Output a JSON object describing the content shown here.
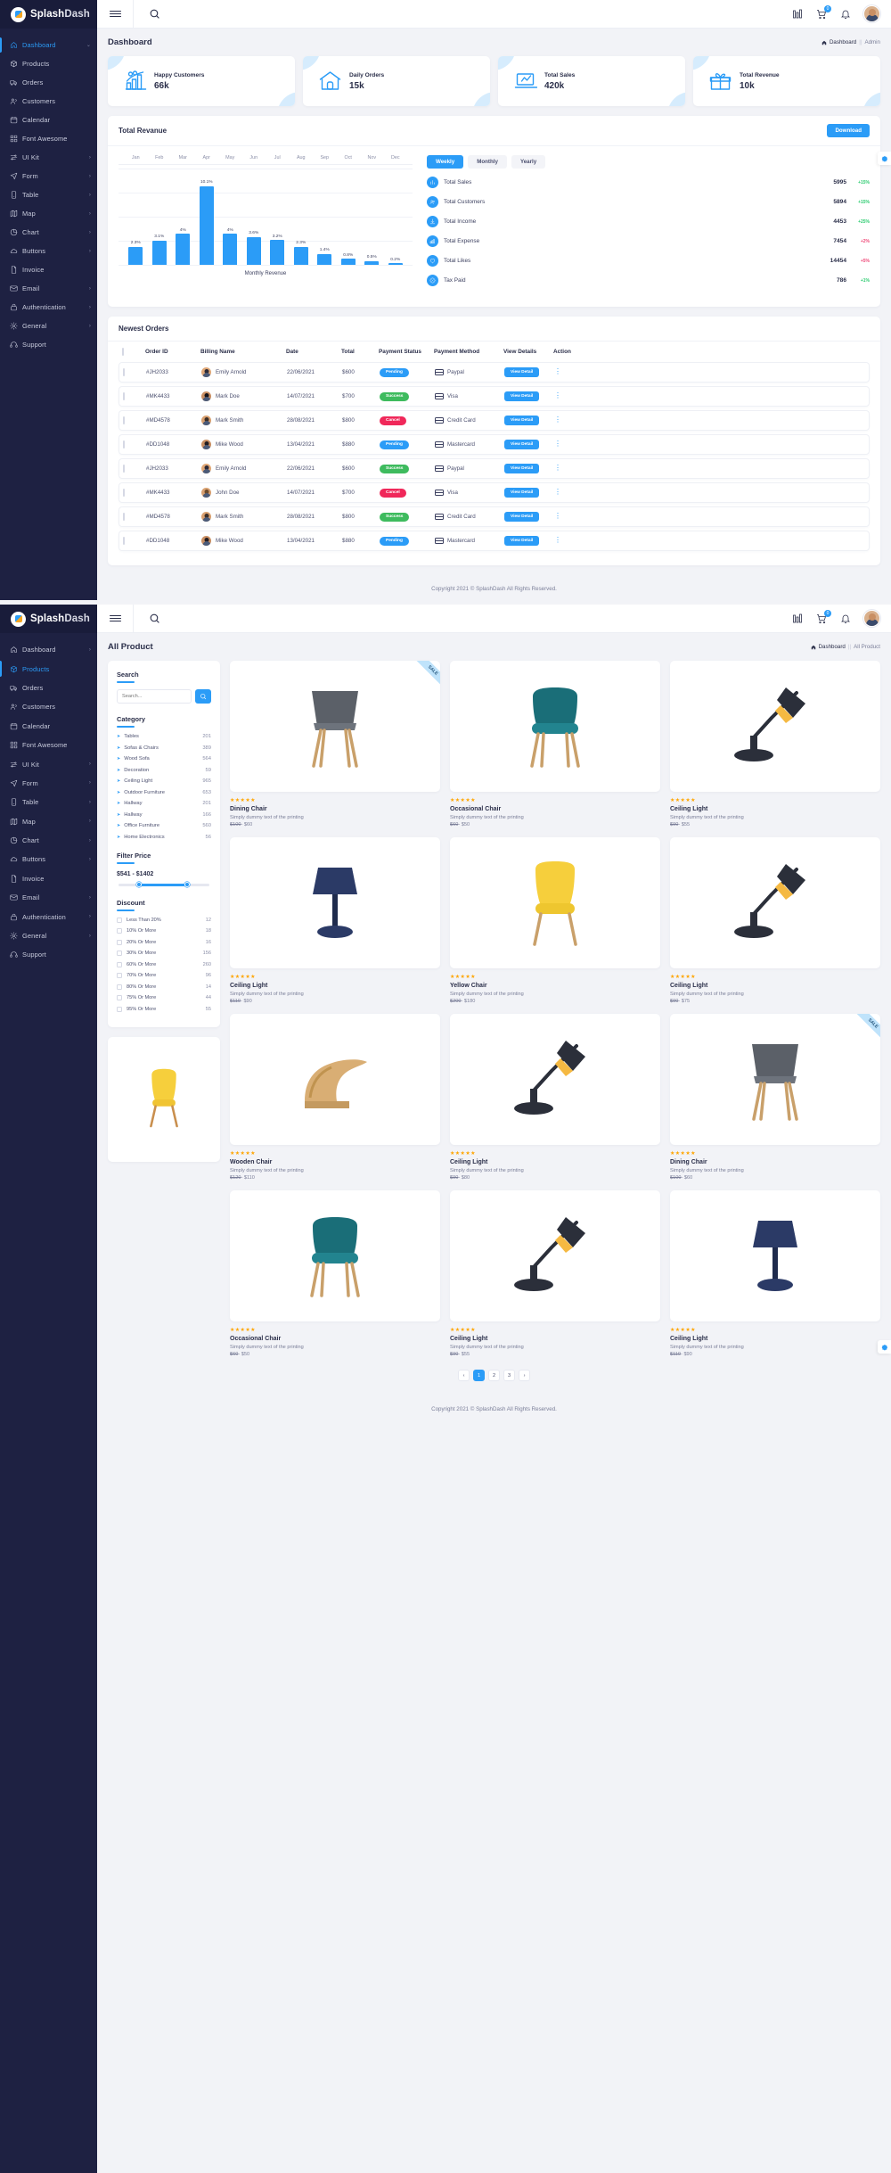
{
  "brand": {
    "part1": "Splash",
    "part2": "Dash"
  },
  "sidebar": {
    "items": [
      {
        "label": "Dashboard",
        "icon": "home-icon",
        "caret": true,
        "active": true
      },
      {
        "label": "Products",
        "icon": "box-icon",
        "caret": false
      },
      {
        "label": "Orders",
        "icon": "truck-icon",
        "caret": false
      },
      {
        "label": "Customers",
        "icon": "users-icon",
        "caret": false
      },
      {
        "label": "Calendar",
        "icon": "calendar-icon",
        "caret": false
      },
      {
        "label": "Font Awesome",
        "icon": "grid-icon",
        "caret": false
      },
      {
        "label": "UI Kit",
        "icon": "sliders-icon",
        "caret": true
      },
      {
        "label": "Form",
        "icon": "send-icon",
        "caret": true
      },
      {
        "label": "Table",
        "icon": "tablet-icon",
        "caret": true
      },
      {
        "label": "Map",
        "icon": "map-icon",
        "caret": true
      },
      {
        "label": "Chart",
        "icon": "pie-icon",
        "caret": true
      },
      {
        "label": "Buttons",
        "icon": "cloud-icon",
        "caret": true
      },
      {
        "label": "Invoice",
        "icon": "file-icon",
        "caret": false
      },
      {
        "label": "Email",
        "icon": "mail-icon",
        "caret": true
      },
      {
        "label": "Authentication",
        "icon": "lock-icon",
        "caret": true
      },
      {
        "label": "General",
        "icon": "settings-icon",
        "caret": true
      },
      {
        "label": "Support",
        "icon": "headset-icon",
        "caret": false
      }
    ]
  },
  "topbar": {
    "menu_icon": "hamburger-icon",
    "search_icon": "search-icon",
    "apps_icon": "apps-grid-icon",
    "cart_icon": "cart-icon",
    "cart_count": "0",
    "bell_icon": "bell-icon",
    "avatar": "user-avatar"
  },
  "dashboard": {
    "title": "Dashboard",
    "breadcrumb": {
      "home": "Dashboard",
      "sep": "||",
      "current": "Admin"
    },
    "stats": [
      {
        "label": "Happy Customers",
        "value": "66k",
        "icon": "growth-chart-icon"
      },
      {
        "label": "Daily Orders",
        "value": "15k",
        "icon": "store-icon"
      },
      {
        "label": "Total Sales",
        "value": "420k",
        "icon": "laptop-sales-icon"
      },
      {
        "label": "Total Revenue",
        "value": "10k",
        "icon": "gift-icon"
      }
    ],
    "revenue": {
      "title": "Total Revanue",
      "download_label": "Download",
      "tabs": [
        {
          "label": "Weekly",
          "active": true
        },
        {
          "label": "Monthly",
          "active": false
        },
        {
          "label": "Yearly",
          "active": false
        }
      ],
      "metrics": [
        {
          "label": "Total Sales",
          "value": "5995",
          "delta": "+15%",
          "dir": "up",
          "icon": "bar-chart-icon"
        },
        {
          "label": "Total Customers",
          "value": "5894",
          "delta": "+15%",
          "dir": "up",
          "icon": "people-icon"
        },
        {
          "label": "Total Income",
          "value": "4453",
          "delta": "+25%",
          "dir": "up",
          "icon": "download-icon"
        },
        {
          "label": "Total Expense",
          "value": "7454",
          "delta": "+2%",
          "dir": "down",
          "icon": "bars-icon"
        },
        {
          "label": "Total Likes",
          "value": "14454",
          "delta": "+5%",
          "dir": "down",
          "icon": "heart-icon"
        },
        {
          "label": "Tax Paid",
          "value": "786",
          "delta": "+1%",
          "dir": "up",
          "icon": "tax-icon"
        }
      ]
    },
    "orders": {
      "title": "Newest Orders",
      "columns": [
        "Order ID",
        "Billing Name",
        "Date",
        "Total",
        "Payment Status",
        "Payment Method",
        "View Details",
        "Action"
      ],
      "rows": [
        {
          "id": "#JH2033",
          "name": "Emily Arnold",
          "date": "22/06/2021",
          "total": "$600",
          "status": "Pending",
          "status_kind": "pending",
          "method": "Paypal",
          "method_icon": "card-icon",
          "view": "View Detail",
          "skin": "#e0a878",
          "hair": "#2d2a36"
        },
        {
          "id": "#MK4433",
          "name": "Mark Doe",
          "date": "14/07/2021",
          "total": "$700",
          "status": "Success",
          "status_kind": "success",
          "method": "Visa",
          "method_icon": "card-icon",
          "view": "View Detail",
          "skin": "#c98f63",
          "hair": "#151318"
        },
        {
          "id": "#MD4578",
          "name": "Mark Smith",
          "date": "28/08/2021",
          "total": "$800",
          "status": "Cancel",
          "status_kind": "cancel",
          "method": "Credit Card",
          "method_icon": "card-icon",
          "view": "View Detail",
          "skin": "#d8a070",
          "hair": "#3b2f28"
        },
        {
          "id": "#DD1048",
          "name": "Mike Wood",
          "date": "13/04/2021",
          "total": "$880",
          "status": "Pending",
          "status_kind": "pending",
          "method": "Mastercard",
          "method_icon": "card-icon",
          "view": "View Detail",
          "skin": "#c98f63",
          "hair": "#221d22"
        },
        {
          "id": "#JH2033",
          "name": "Emily Arnold",
          "date": "22/06/2021",
          "total": "$600",
          "status": "Success",
          "status_kind": "success",
          "method": "Paypal",
          "method_icon": "card-icon",
          "view": "View Detail",
          "skin": "#e0a878",
          "hair": "#2d2a36"
        },
        {
          "id": "#MK4433",
          "name": "John Doe",
          "date": "14/07/2021",
          "total": "$700",
          "status": "Cancel",
          "status_kind": "cancel",
          "method": "Visa",
          "method_icon": "card-icon",
          "view": "View Detail",
          "skin": "#d8a070",
          "hair": "#6b4a2c"
        },
        {
          "id": "#MD4578",
          "name": "Mark Smith",
          "date": "28/08/2021",
          "total": "$800",
          "status": "Success",
          "status_kind": "success",
          "method": "Credit Card",
          "method_icon": "card-icon",
          "view": "View Detail",
          "skin": "#d8a070",
          "hair": "#3b2f28"
        },
        {
          "id": "#DD1048",
          "name": "Mike Wood",
          "date": "13/04/2021",
          "total": "$880",
          "status": "Pending",
          "status_kind": "pending",
          "method": "Mastercard",
          "method_icon": "card-icon",
          "view": "View Detail",
          "skin": "#c98f63",
          "hair": "#221d22"
        }
      ]
    },
    "footer": "Copyright 2021 © SplashDash All Rights Reserved."
  },
  "chart_data": {
    "type": "bar",
    "title": "Total Revanue",
    "xlabel": "Monthly Revenue",
    "ylabel": "",
    "grid": true,
    "ylim": [
      0,
      11
    ],
    "categories": [
      "Jan",
      "Feb",
      "Mar",
      "Apr",
      "May",
      "Jun",
      "Jul",
      "Aug",
      "Sep",
      "Oct",
      "Nov",
      "Dec"
    ],
    "values": [
      2.3,
      3.1,
      4.0,
      10.1,
      4.0,
      3.6,
      3.2,
      2.3,
      1.4,
      0.8,
      0.5,
      0.2
    ],
    "labels": [
      "2.3%",
      "3.1%",
      "4%",
      "10.1%",
      "4%",
      "3.6%",
      "3.2%",
      "2.3%",
      "1.4%",
      "0.8%",
      "0.5%",
      "0.2%"
    ],
    "series_color": "#2b9cf7"
  },
  "products": {
    "title": "All Product",
    "breadcrumb": {
      "home": "Dashboard",
      "sep": "||",
      "current": "All Product"
    },
    "search": {
      "title": "Search",
      "placeholder": "Search...",
      "button_icon": "search-icon"
    },
    "category": {
      "title": "Category",
      "items": [
        {
          "name": "Tables",
          "count": "201"
        },
        {
          "name": "Sofas & Chairs",
          "count": "389"
        },
        {
          "name": "Wood Sofa",
          "count": "564"
        },
        {
          "name": "Decoration",
          "count": "59"
        },
        {
          "name": "Ceiling Light",
          "count": "965"
        },
        {
          "name": "Outdoor Furniture",
          "count": "653"
        },
        {
          "name": "Hallway",
          "count": "201"
        },
        {
          "name": "Hallway",
          "count": "166"
        },
        {
          "name": "Office Furniture",
          "count": "560"
        },
        {
          "name": "Home Electronics",
          "count": "56"
        }
      ]
    },
    "filter_price": {
      "title": "Filter Price",
      "range": "$541 - $1402"
    },
    "discount": {
      "title": "Discount",
      "items": [
        {
          "name": "Less Than 20%",
          "count": "12"
        },
        {
          "name": "10% Or More",
          "count": "18"
        },
        {
          "name": "20% Or More",
          "count": "16"
        },
        {
          "name": "30% Or More",
          "count": "156"
        },
        {
          "name": "60% Or More",
          "count": "260"
        },
        {
          "name": "70% Or More",
          "count": "96"
        },
        {
          "name": "80% Or More",
          "count": "14"
        },
        {
          "name": "75% Or More",
          "count": "44"
        },
        {
          "name": "95% Or More",
          "count": "55"
        }
      ]
    },
    "sale_badge": "SALE",
    "grid": [
      {
        "name": "Dining Chair",
        "desc": "Simply dummy text of the printing",
        "price_old": "$100",
        "price_new": "$60",
        "stars": "★★★★★",
        "img": "chair-grey",
        "sale": true
      },
      {
        "name": "Occasional Chair",
        "desc": "Simply dummy text of the printing",
        "price_old": "$60",
        "price_new": "$50",
        "stars": "★★★★★",
        "img": "chair-teal",
        "sale": false
      },
      {
        "name": "Ceiling Light",
        "desc": "Simply dummy text of the printing",
        "price_old": "$90",
        "price_new": "$55",
        "stars": "★★★★★",
        "img": "lamp-desk",
        "sale": false
      },
      {
        "name": "Ceiling Light",
        "desc": "Simply dummy text of the printing",
        "price_old": "$110",
        "price_new": "$90",
        "stars": "★★★★★",
        "img": "lamp-table",
        "sale": false
      },
      {
        "name": "Yellow Chair",
        "desc": "Simply dummy text of the printing",
        "price_old": "$200",
        "price_new": "$180",
        "stars": "★★★★★",
        "img": "chair-yellow",
        "sale": false
      },
      {
        "name": "Ceiling Light",
        "desc": "Simply dummy text of the printing",
        "price_old": "$90",
        "price_new": "$75",
        "stars": "★★★★★",
        "img": "lamp-black",
        "sale": false
      },
      {
        "name": "Wooden Chair",
        "desc": "Simply dummy text of the printing",
        "price_old": "$120",
        "price_new": "$110",
        "stars": "★★★★★",
        "img": "chair-wood",
        "sale": false
      },
      {
        "name": "Ceiling Light",
        "desc": "Simply dummy text of the printing",
        "price_old": "$90",
        "price_new": "$80",
        "stars": "★★★★★",
        "img": "lamp-desk2",
        "sale": false
      },
      {
        "name": "Dining Chair",
        "desc": "Simply dummy text of the printing",
        "price_old": "$100",
        "price_new": "$60",
        "stars": "★★★★★",
        "img": "chair-grey2",
        "sale": true
      },
      {
        "name": "Occasional Chair",
        "desc": "Simply dummy text of the printing",
        "price_old": "$60",
        "price_new": "$50",
        "stars": "★★★★★",
        "img": "chair-teal2",
        "sale": false
      },
      {
        "name": "Ceiling Light",
        "desc": "Simply dummy text of the printing",
        "price_old": "$90",
        "price_new": "$55",
        "stars": "★★★★★",
        "img": "lamp-desk3",
        "sale": false
      },
      {
        "name": "Ceiling Light",
        "desc": "Simply dummy text of the printing",
        "price_old": "$110",
        "price_new": "$90",
        "stars": "★★★★★",
        "img": "lamp-table2",
        "sale": false
      }
    ],
    "pagination": {
      "prev": "‹",
      "pages": [
        "1",
        "2",
        "3"
      ],
      "next": "›",
      "active": "1"
    },
    "footer": "Copyright 2021 © SplashDash All Rights Reserved."
  },
  "colors": {
    "accent": "#2b9cf7",
    "sidebar": "#1e2142",
    "success": "#3ebb5e",
    "danger": "#f0285a",
    "bg": "#f2f3f7"
  }
}
